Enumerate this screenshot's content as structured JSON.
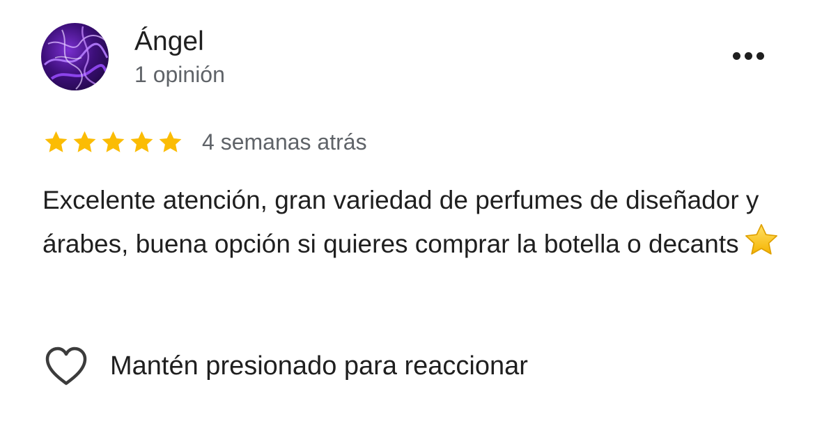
{
  "review": {
    "reviewer_name": "Ángel",
    "review_count": "1 opinión",
    "avatar_icon": "avatar-image",
    "more_icon": "more-horizontal-icon",
    "rating": 5,
    "rating_max": 5,
    "star_color": "#fbbc04",
    "date": "4 semanas atrás",
    "text": "Excelente atención, gran variedad de perfumes de diseñador y árabes, buena opción si quieres comprar la botella o decants",
    "text_emoji_icon": "star-emoji-icon",
    "react_icon": "heart-outline-icon",
    "react_label": "Mantén presionado para reaccionar"
  }
}
